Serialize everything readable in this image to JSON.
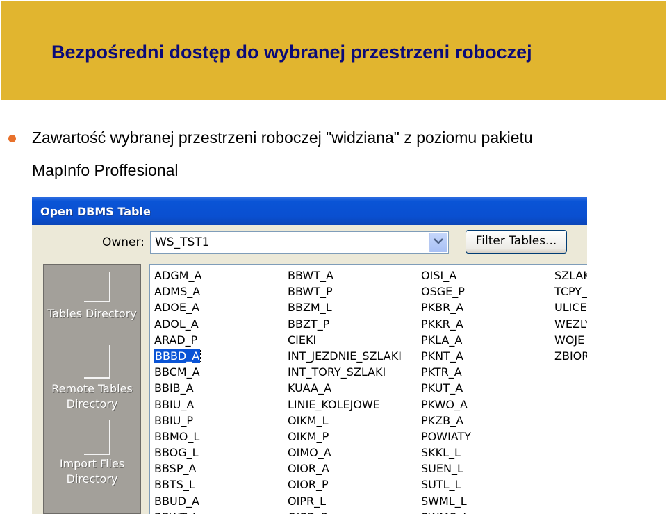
{
  "slide": {
    "title": "Bezpośredni dostęp do wybranej przestrzeni roboczej",
    "bullet_line1": "Zawartość wybranej przestrzeni roboczej \"widziana\" z poziomu pakietu",
    "bullet_line2": "MapInfo Proffesional",
    "colors": {
      "title_band": "#e1b52f",
      "title_text": "#0b0b78",
      "bullet": "#e8712b"
    }
  },
  "dialog": {
    "title": "Open DBMS Table",
    "owner_label": "Owner:",
    "owner_value": "WS_TST1",
    "filter_button": "Filter Tables...",
    "side_items": [
      {
        "label1": "Tables Directory",
        "label2": ""
      },
      {
        "label1": "Remote Tables",
        "label2": "Directory"
      },
      {
        "label1": "Import Files",
        "label2": "Directory"
      }
    ],
    "selected_item": "BBBD_A",
    "columns": [
      [
        "ADGM_A",
        "ADMS_A",
        "ADOE_A",
        "ADOL_A",
        "ARAD_P",
        "BBBD_A",
        "BBCM_A",
        "BBIB_A",
        "BBIU_A",
        "BBIU_P",
        "BBMO_L",
        "BBOG_L",
        "BBSP_A",
        "BBTS_L",
        "BBUD_A",
        "BBWT_L"
      ],
      [
        "BBWT_A",
        "BBWT_P",
        "BBZM_L",
        "BBZT_P",
        "CIEKI",
        "INT_JEZDNIE_SZLAKI",
        "INT_TORY_SZLAKI",
        "KUAA_A",
        "LINIE_KOLEJOWE",
        "OIKM_L",
        "OIKM_P",
        "OIMO_A",
        "OIOR_A",
        "OIOR_P",
        "OIPR_L",
        "OISD_P"
      ],
      [
        "OISI_A",
        "OSGE_P",
        "PKBR_A",
        "PKKR_A",
        "PKLA_A",
        "PKNT_A",
        "PKTR_A",
        "PKUT_A",
        "PKWO_A",
        "PKZB_A",
        "POWIATY",
        "SKKL_L",
        "SUEN_L",
        "SUTL_L",
        "SWML_L",
        "SWMO_L"
      ],
      [
        "SZLAKI",
        "TCPY_",
        "ULICE",
        "WEZLY",
        "WOJE",
        "ZBIOR"
      ]
    ]
  }
}
